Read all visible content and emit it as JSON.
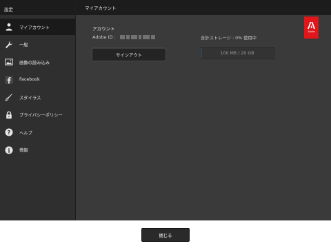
{
  "sidebar": {
    "title": "設定",
    "items": [
      {
        "label": "マイアカウント",
        "icon": "user-icon",
        "active": true
      },
      {
        "label": "一般",
        "icon": "wrench-icon",
        "active": false
      },
      {
        "label": "画像の読み込み",
        "icon": "image-icon",
        "active": false
      },
      {
        "label": "Facebook",
        "icon": "facebook-icon",
        "active": false
      },
      {
        "label": "スタイラス",
        "icon": "stylus-icon",
        "active": false
      },
      {
        "label": "プライバシーポリシー",
        "icon": "lock-icon",
        "active": false
      },
      {
        "label": "ヘルプ",
        "icon": "help-icon",
        "active": false
      },
      {
        "label": "情報",
        "icon": "info-icon",
        "active": false
      }
    ]
  },
  "main": {
    "title": "マイアカウント",
    "account_heading": "アカウント",
    "adobe_id_label": "Adobe ID :",
    "signout_label": "サインアウト",
    "storage_label": "合計ストレージ : 0% 使用中",
    "storage_usage": "100 MB / 20 GB",
    "storage_percent": 0,
    "logo_text": "Adobe"
  },
  "footer": {
    "close_label": "閉じる"
  },
  "colors": {
    "adobe_red": "#e0161a",
    "sidebar_bg": "#2f2f2f",
    "main_bg": "#3a3a3a",
    "header_bg": "#1c1c1c"
  }
}
